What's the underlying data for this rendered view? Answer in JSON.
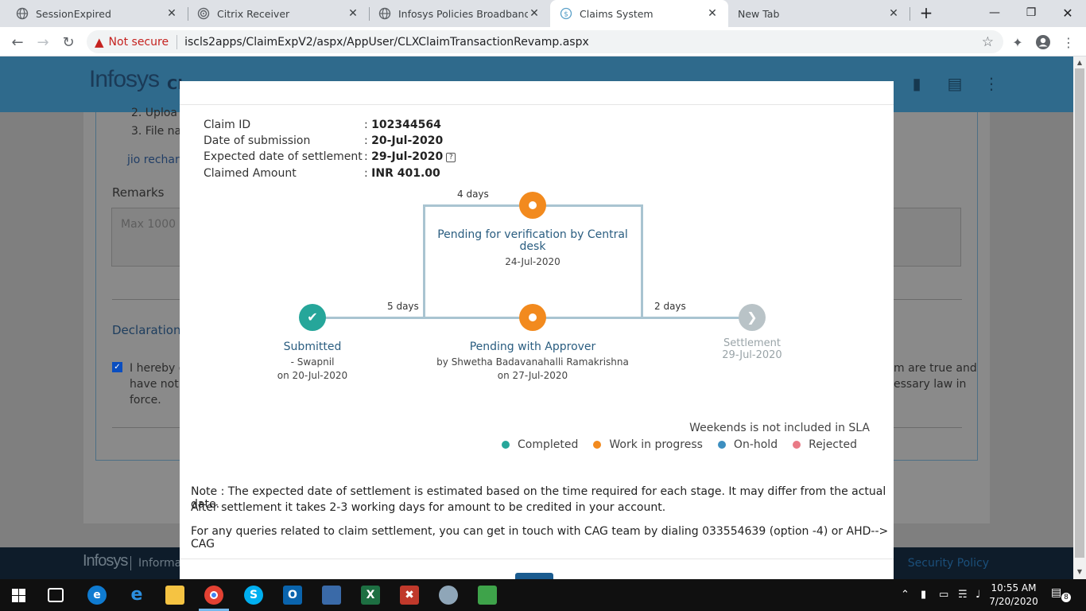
{
  "browser": {
    "tabs": [
      {
        "title": "SessionExpired",
        "icon": "globe-icon"
      },
      {
        "title": "Citrix Receiver",
        "icon": "citrix-icon"
      },
      {
        "title": "Infosys Policies Broadband",
        "icon": "globe-icon"
      },
      {
        "title": "Claims System",
        "icon": "claims-icon",
        "active": true
      },
      {
        "title": "New Tab",
        "icon": ""
      }
    ],
    "new_tab_label": "+",
    "security_label": "Not secure",
    "url": "iscls2apps/ClaimExpV2/aspx/AppUser/CLXClaimTransactionRevamp.aspx"
  },
  "background_page": {
    "logo": "Infosys",
    "logo_suffix": "CL",
    "list_item_2": "2. Uploa",
    "list_item_3": "3. File nar",
    "attachment_link": "jio recharg",
    "remarks_label": "Remarks",
    "remarks_placeholder": "Max 1000 C",
    "declaration_label": "Declaration",
    "declaration_text_1": "I hereby d",
    "declaration_text_2": "have not l",
    "declaration_text_3": "force.",
    "declaration_right_1": "m are true and",
    "declaration_right_2": "essary law in",
    "footer_logo": "Infosys",
    "footer_info": "Informat",
    "footer_security": "Security Policy"
  },
  "claim": {
    "fields": [
      {
        "label": "Claim ID",
        "value": "102344564"
      },
      {
        "label": "Date of submission",
        "value": "20-Jul-2020"
      },
      {
        "label": "Expected date of settlement",
        "value": "29-Jul-2020"
      },
      {
        "label": "Claimed Amount",
        "value": "INR 401.00"
      }
    ],
    "separator": ":",
    "help_icon_label": "?"
  },
  "workflow": {
    "submitted": {
      "title": "Submitted",
      "by": "- Swapnil",
      "date": "on 20-Jul-2020"
    },
    "verification": {
      "title_line1": "Pending for verification by Central",
      "title_line2": "desk",
      "date": "24-Jul-2020",
      "duration": "4 days"
    },
    "approver": {
      "title": "Pending with Approver",
      "by": "by Shwetha Badavanahalli Ramakrishna",
      "date": "on 27-Jul-2020",
      "duration": "5 days"
    },
    "settlement": {
      "title": "Settlement",
      "date": "29-Jul-2020",
      "duration": "2 days"
    }
  },
  "legend": {
    "note": "Weekends is not included in SLA",
    "items": [
      {
        "label": "Completed",
        "color": "#26a69a"
      },
      {
        "label": "Work in progress",
        "color": "#f28a1e"
      },
      {
        "label": "On-hold",
        "color": "#3d8fc0"
      },
      {
        "label": "Rejected",
        "color": "#e97a86"
      }
    ]
  },
  "notes": {
    "line1": "Note : The expected date of settlement is estimated based on the time required for each stage. It may differ from the actual date.",
    "line2": "After settlement it takes 2-3 working days for amount to be credited in your account.",
    "line3": "For any queries related to claim settlement, you can get in touch with CAG team by dialing 033554639 (option -4) or AHD--> CAG"
  },
  "taskbar": {
    "time": "10:55 AM",
    "date": "7/20/2020",
    "notification_count": "8"
  }
}
